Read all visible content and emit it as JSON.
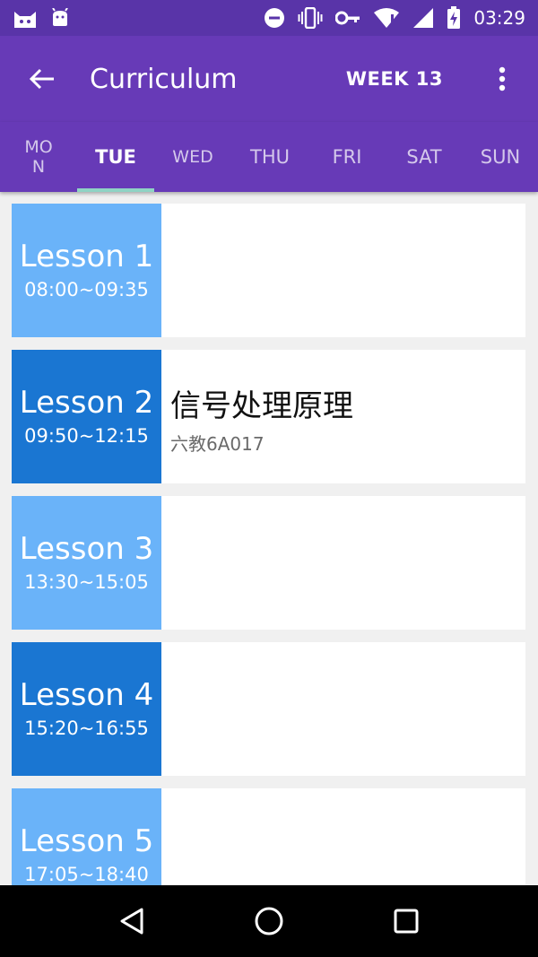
{
  "status_bar": {
    "time": "03:29",
    "icons": [
      "cat-icon",
      "android-icon",
      "do-not-disturb-icon",
      "vibrate-icon",
      "key-icon",
      "wifi-icon",
      "signal-icon",
      "battery-charging-icon"
    ]
  },
  "app_bar": {
    "title": "Curriculum",
    "week": "WEEK 13",
    "back_icon": "arrow-back-icon",
    "more_icon": "more-vert-icon"
  },
  "tabs": [
    {
      "label": "MON",
      "active": false
    },
    {
      "label": "TUE",
      "active": true
    },
    {
      "label": "WED",
      "active": false
    },
    {
      "label": "THU",
      "active": false
    },
    {
      "label": "FRI",
      "active": false
    },
    {
      "label": "SAT",
      "active": false
    },
    {
      "label": "SUN",
      "active": false
    }
  ],
  "lessons": [
    {
      "name": "Lesson 1",
      "time": "08:00~09:35",
      "course": "",
      "room": "",
      "color": "#6ab3f9"
    },
    {
      "name": "Lesson 2",
      "time": "09:50~12:15",
      "course": "信号处理原理",
      "room": "六教6A017",
      "color": "#1a76d2"
    },
    {
      "name": "Lesson 3",
      "time": "13:30~15:05",
      "course": "",
      "room": "",
      "color": "#6ab3f9"
    },
    {
      "name": "Lesson 4",
      "time": "15:20~16:55",
      "course": "",
      "room": "",
      "color": "#1a76d2"
    },
    {
      "name": "Lesson 5",
      "time": "17:05~18:40",
      "course": "",
      "room": "",
      "color": "#6ab3f9"
    }
  ],
  "colors": {
    "primary": "#673ab7",
    "primary_dark": "#5934a8",
    "tab_indicator": "#8fd3c4",
    "lesson_light": "#6ab3f9",
    "lesson_dark": "#1a76d2"
  },
  "nav_bar": {
    "back_icon": "nav-back-triangle-icon",
    "home_icon": "nav-home-circle-icon",
    "recents_icon": "nav-recents-square-icon"
  }
}
